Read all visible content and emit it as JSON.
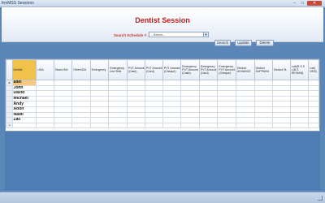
{
  "window": {
    "title": "frmMSS Sessions",
    "min": "–",
    "max": "□",
    "close": "✕"
  },
  "header": {
    "title": "Dentist Session"
  },
  "search": {
    "label": "Search Schedule # :",
    "select_value": "--Select--",
    "arrow": "▼"
  },
  "buttons": {
    "search": "Search",
    "update": "Update",
    "delete": "Delete"
  },
  "grid": {
    "columns": [
      "Dentist",
      "UDA",
      "DeanUDA",
      "OtherUDA",
      "Emergency",
      "Emergency 2nd Shift",
      "PVT Amount (Cash)",
      "PVT Amount (Card)",
      "PVT Amount (Cheque)",
      "Emergency PVT Amount (Cash)",
      "Emergency PVT Amount (Card)",
      "Emergency PVT Amount (Cheque)",
      "Deduct ADVANCE",
      "Deduct SUPPARA",
      "Deduct SL",
      "Lab(R S K L/B S RE/HAN)",
      "Lab( DEN)"
    ],
    "rows": [
      {
        "marker": "▸",
        "dentist": "adel"
      },
      {
        "marker": "",
        "dentist": "John"
      },
      {
        "marker": "",
        "dentist": "David"
      },
      {
        "marker": "",
        "dentist": "Michael"
      },
      {
        "marker": "",
        "dentist": "Andy"
      },
      {
        "marker": "",
        "dentist": "Adolf"
      },
      {
        "marker": "",
        "dentist": "Nabil"
      },
      {
        "marker": "",
        "dentist": "Zac"
      },
      {
        "marker": "*",
        "dentist": ""
      }
    ],
    "selected_column": "Dentist",
    "accent": "#f0c24a"
  },
  "colors": {
    "title_red": "#c01a1a",
    "background": "#5a86b8"
  }
}
